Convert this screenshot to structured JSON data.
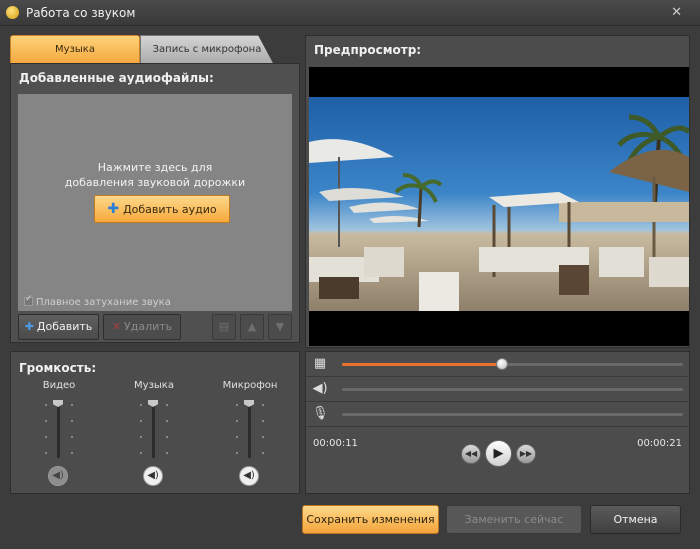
{
  "window": {
    "title": "Работа со звуком",
    "close_icon": "close-icon"
  },
  "tabs": [
    {
      "label": "Музыка",
      "active": true
    },
    {
      "label": "Запись с микрофона",
      "active": false
    }
  ],
  "audio_files": {
    "header": "Добавленные аудиофайлы:",
    "hint_line1": "Нажмите здесь для",
    "hint_line2": "добавления звуковой дорожки",
    "add_audio_label": "Добавить аудио",
    "smooth_fade_label": "Плавное затухание звука",
    "smooth_fade_checked": true,
    "add_label": "Добавить",
    "delete_label": "Удалить"
  },
  "volume": {
    "header": "Громкость:",
    "channels": [
      {
        "label": "Видео",
        "level": 1.0,
        "muted": true
      },
      {
        "label": "Музыка",
        "level": 1.0,
        "muted": false
      },
      {
        "label": "Микрофон",
        "level": 1.0,
        "muted": false
      }
    ]
  },
  "preview": {
    "header": "Предпросмотр:",
    "current_time": "00:00:11",
    "total_time": "00:00:21",
    "video_progress": 0.47
  },
  "footer": {
    "save_label": "Сохранить изменения",
    "replace_label": "Заменить сейчас",
    "cancel_label": "Отмена"
  },
  "colors": {
    "accent": "#f5a83c",
    "progress": "#e8722d"
  }
}
